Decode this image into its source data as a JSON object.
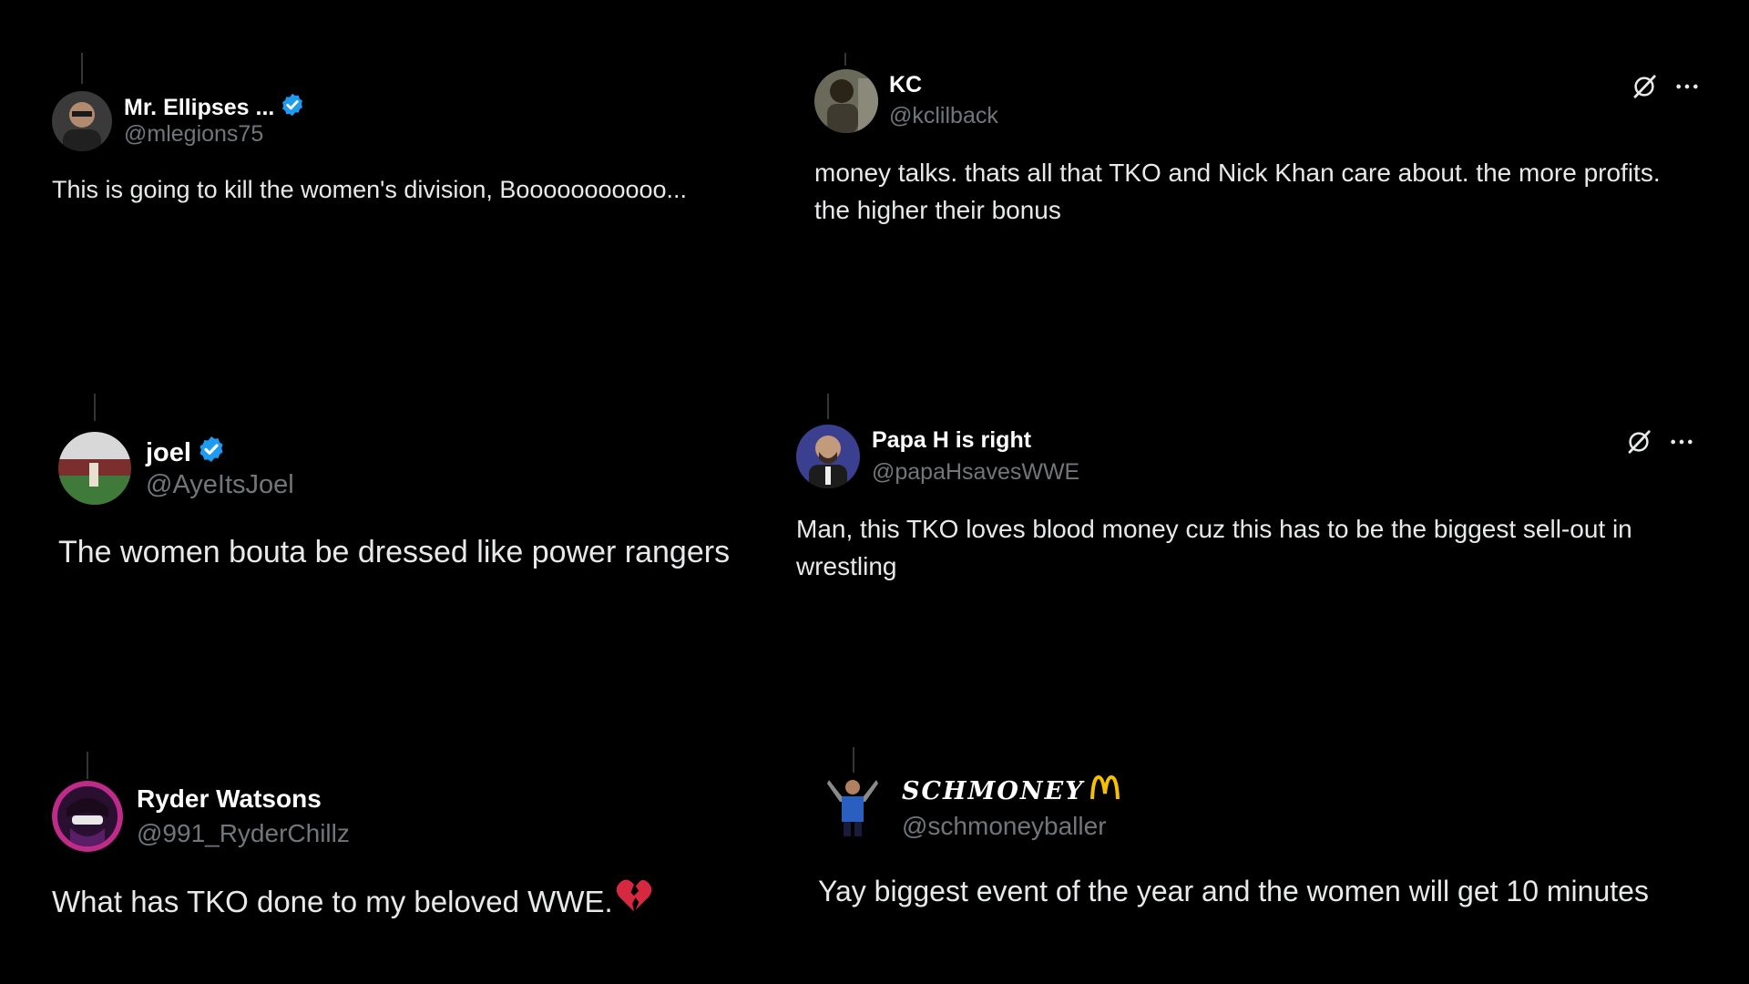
{
  "tweets": [
    {
      "display_name": "Mr. Ellipses ...",
      "handle": "@mlegions75",
      "verified": true,
      "text": "This is going to kill the women's division, Booooooooooo..."
    },
    {
      "display_name": "KC",
      "handle": "@kclilback",
      "verified": false,
      "text": "money talks.  thats all that TKO and Nick Khan care about. the more profits. the higher their bonus"
    },
    {
      "display_name": "joel",
      "handle": "@AyeItsJoel",
      "verified": true,
      "text": "The women bouta be dressed like power rangers"
    },
    {
      "display_name": "Papa H is right",
      "handle": "@papaHsavesWWE",
      "verified": false,
      "text": "Man, this TKO loves blood money cuz this has to be the biggest sell-out in wrestling"
    },
    {
      "display_name": "Ryder Watsons",
      "handle": "@991_RyderChillz",
      "verified": false,
      "text": "What has TKO done to my beloved WWE.",
      "emoji": "broken-heart"
    },
    {
      "display_name": "SCHMONEY",
      "handle": "@schmoneyballer",
      "verified": false,
      "text": "Yay biggest event of the year and the women will get 10 minutes"
    }
  ],
  "icons": {
    "grok": "grok-icon",
    "more": "more-icon",
    "verified": "verified-badge-icon",
    "broken_heart": "broken-heart-icon",
    "arches": "golden-arches-icon"
  },
  "colors": {
    "background": "#000000",
    "text": "#e7e9ea",
    "muted": "#71767b",
    "verified": "#1d9bf0",
    "broken_heart": "#d62840",
    "arches": "#f5c000"
  }
}
